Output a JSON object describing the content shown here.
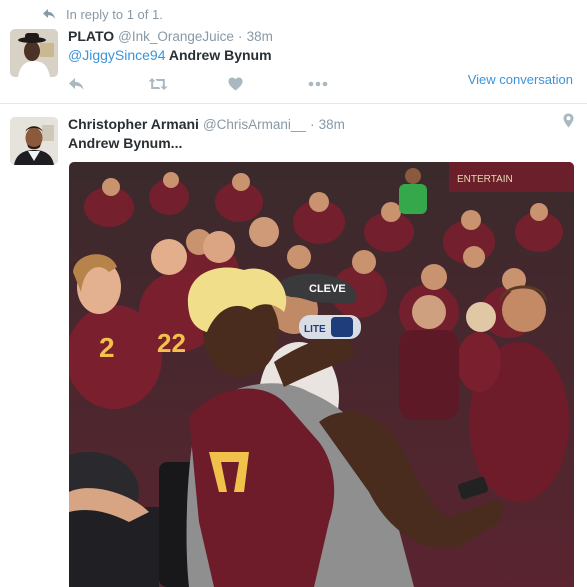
{
  "reply_context": {
    "text": "In reply to 1 of 1.",
    "icon": "reply-arrow-icon"
  },
  "tweet1": {
    "name": "PLATO",
    "handle": "@Ink_OrangeJuice",
    "separator": "·",
    "time": "38m",
    "mention": "@JiggySince94",
    "text": "Andrew Bynum",
    "actions": [
      "reply-icon",
      "retweet-icon",
      "like-icon",
      "more-icon"
    ],
    "view_conversation": "View conversation"
  },
  "tweet2": {
    "name": "Christopher Armani",
    "handle": "@ChrisArmani__",
    "separator": "·",
    "time": "38m",
    "text": "Andrew Bynum...",
    "location_icon": "location-pin-icon"
  },
  "photo": {
    "can_label": "LITE",
    "hat_label": "CLEVE",
    "banner_text": "ENTERTAIN",
    "jersey_number": "22"
  },
  "colors": {
    "link": "#3b94d9",
    "muted": "#8899a6",
    "text": "#292f33",
    "wine": "#7a1f2e",
    "gold": "#f0c24b"
  }
}
